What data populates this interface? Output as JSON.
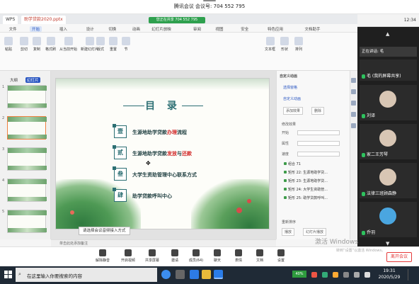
{
  "meeting": {
    "header_title": "腾讯会议 会议号: 704 552 795",
    "side_time": "12:34",
    "speaking_label": "正在讲话: 毛",
    "participants": [
      {
        "name": "毛 (我的屏幕共享)",
        "mic": true
      },
      {
        "name": "刘译"
      },
      {
        "name": "家二王芳琴"
      },
      {
        "name": "法律三班顾森静"
      },
      {
        "name": "乔羽"
      }
    ],
    "toolbar": [
      {
        "label": "解除静音",
        "icon": "mic-icon"
      },
      {
        "label": "开启视频",
        "icon": "camera-icon"
      },
      {
        "label": "共享屏幕",
        "icon": "screen-share-icon"
      },
      {
        "label": "邀请",
        "icon": "invite-icon"
      },
      {
        "label": "成员(64)",
        "icon": "members-icon"
      },
      {
        "label": "聊天",
        "icon": "chat-icon"
      },
      {
        "label": "表情",
        "icon": "emoji-icon"
      },
      {
        "label": "文档",
        "icon": "document-icon"
      },
      {
        "label": "设置",
        "icon": "settings-icon"
      }
    ],
    "leave_label": "离开会议"
  },
  "wps": {
    "tabs": [
      "WPS",
      "助学贷款2020.pptx"
    ],
    "share_indicator": "您正在共享 704 552 795",
    "menus": [
      "文件",
      "开始",
      "插入",
      "设计",
      "切换",
      "动画",
      "幻灯片放映",
      "审阅",
      "视图",
      "安全",
      "特色应用",
      "文档助手"
    ],
    "active_menu": "开始",
    "ribbon": [
      {
        "label": "粘贴"
      },
      {
        "label": "剪切"
      },
      {
        "label": "复制"
      },
      {
        "label": "格式刷"
      },
      {
        "label": "从当前开始"
      },
      {
        "label": "新建幻灯片"
      },
      {
        "label": "版式"
      },
      {
        "label": "重置"
      },
      {
        "label": "节"
      },
      {
        "label": "文本框"
      },
      {
        "label": "形状"
      },
      {
        "label": "排列"
      }
    ],
    "thumb_tabs": [
      "大纲",
      "幻灯片"
    ],
    "slide_count": 5,
    "selected_slide": 2,
    "slide": {
      "title": "目 录",
      "items": [
        {
          "num": "壹",
          "text_a": "生源地助学贷款",
          "text_b": "办理",
          "text_c": "流程"
        },
        {
          "num": "贰",
          "text_a": "生源地助学贷款",
          "text_b": "发放",
          "text_c": "与",
          "text_d": "还款"
        },
        {
          "num": "叁",
          "text_a": "大学生资助管理中心联系方式"
        },
        {
          "num": "肆",
          "text_a": "助学贷款呼叫中心"
        }
      ]
    },
    "tooltip": "请选择会议音频接入方式",
    "notes_placeholder": "单击此处添加备注",
    "anim_pane": {
      "title": "自定义动画",
      "select_pane": "选择窗格",
      "add_effect": "添加效果",
      "remove": "删除",
      "modify_label": "修改效果",
      "start_label": "开始",
      "property_label": "属性",
      "speed_label": "速度",
      "rows": [
        "组合 71",
        "矩形 22: 生源地助学贷...",
        "矩形 23: 生源地助学贷...",
        "矩形 24: 大学生资助管...",
        "矩形 25: 助学贷款呼叫..."
      ],
      "reorder": "重新排序",
      "play": "播放",
      "preview": "幻灯片播放"
    }
  },
  "windows": {
    "search_placeholder": "在这里输入你要搜索的内容",
    "activate_title": "激活 Windows",
    "activate_sub": "转到“设置”以激活 Windows。",
    "battery": "40%",
    "time": "19:31",
    "date": "2020/5/29"
  },
  "colors": {
    "accent": "#2c6f73",
    "red_text": "#d12727",
    "leave": "#e53a3a",
    "taskbar": "#1f2a36"
  }
}
